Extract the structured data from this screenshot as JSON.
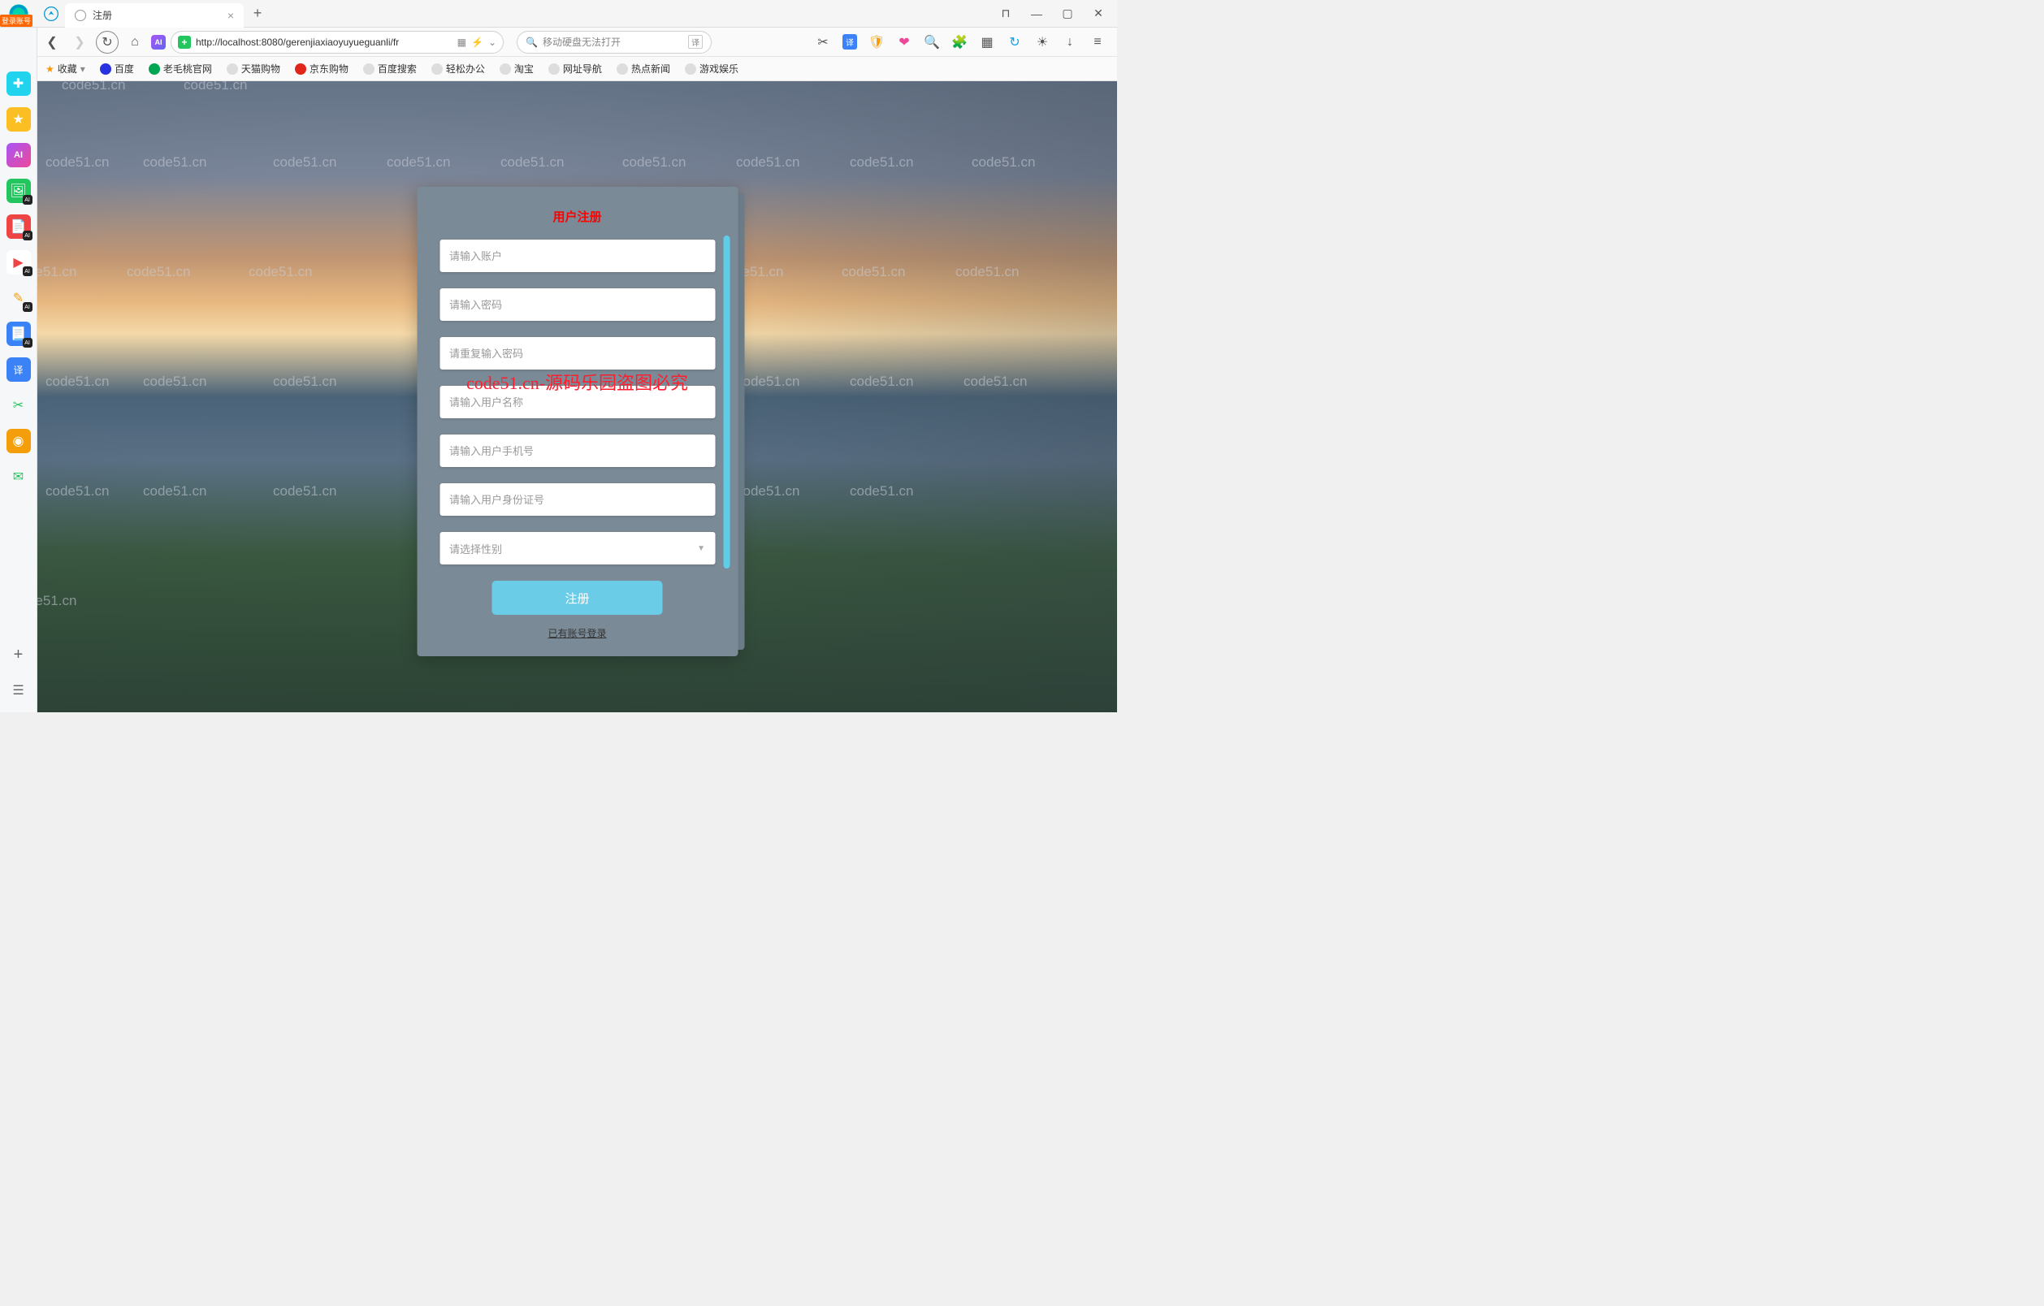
{
  "window": {
    "tab_title": "注册",
    "login_badge": "登录账号",
    "win_pin": "⊓",
    "win_min": "—",
    "win_max": "▢",
    "win_close": "✕"
  },
  "addr": {
    "url_host": "localhost",
    "url_full": "http://localhost:8080/gerenjiaxiaoyuyueguanli/fr",
    "translate": "译",
    "search_placeholder": "移动硬盘无法打开"
  },
  "bookmarks": {
    "fav": "收藏",
    "baidu": "百度",
    "laomaotao": "老毛桃官网",
    "tmall": "天猫购物",
    "jd": "京东购物",
    "baidusearch": "百度搜索",
    "qingsong": "轻松办公",
    "taobao": "淘宝",
    "nav": "网址导航",
    "hotnews": "热点新闻",
    "gameent": "游戏娱乐"
  },
  "form": {
    "title": "用户注册",
    "account_ph": "请输入账户",
    "password_ph": "请输入密码",
    "password2_ph": "请重复输入密码",
    "username_ph": "请输入用户名称",
    "phone_ph": "请输入用户手机号",
    "idcard_ph": "请输入用户身份证号",
    "gender_ph": "请选择性别",
    "submit": "注册",
    "login_link": "已有账号登录"
  },
  "watermark": {
    "text": "code51.cn",
    "red": "code51.cn-源码乐园盗图必究"
  }
}
